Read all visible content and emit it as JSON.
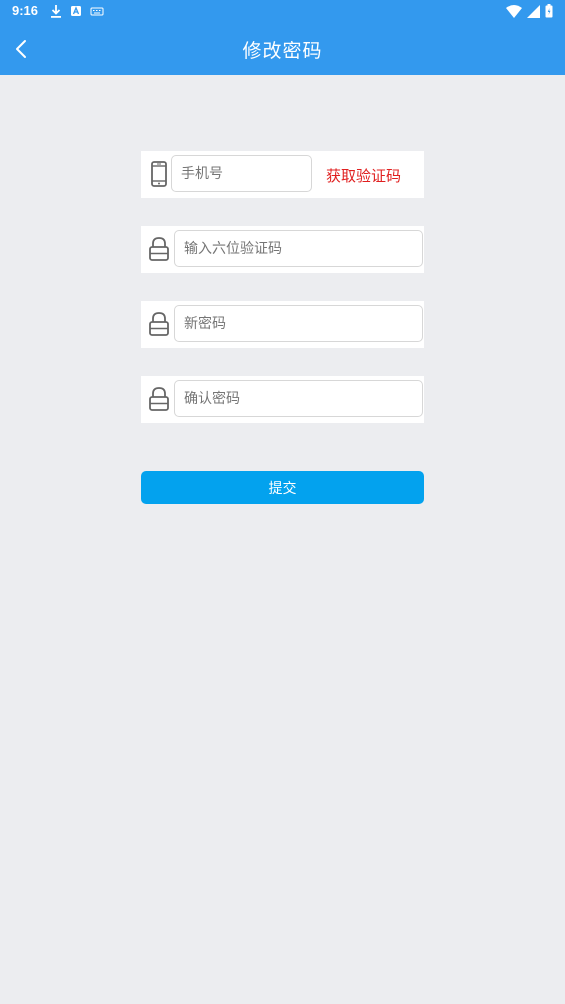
{
  "status_bar": {
    "time": "9:16"
  },
  "header": {
    "title": "修改密码"
  },
  "form": {
    "phone_placeholder": "手机号",
    "get_code_label": "获取验证码",
    "code_placeholder": "输入六位验证码",
    "new_password_placeholder": "新密码",
    "confirm_password_placeholder": "确认密码",
    "submit_label": "提交"
  },
  "colors": {
    "primary": "#3399ee",
    "submit": "#03a2ee",
    "code_link": "#e02020",
    "background": "#ecedf0"
  },
  "icons": {
    "back": "chevron-left-icon",
    "phone": "smartphone-icon",
    "lock": "lock-icon"
  }
}
